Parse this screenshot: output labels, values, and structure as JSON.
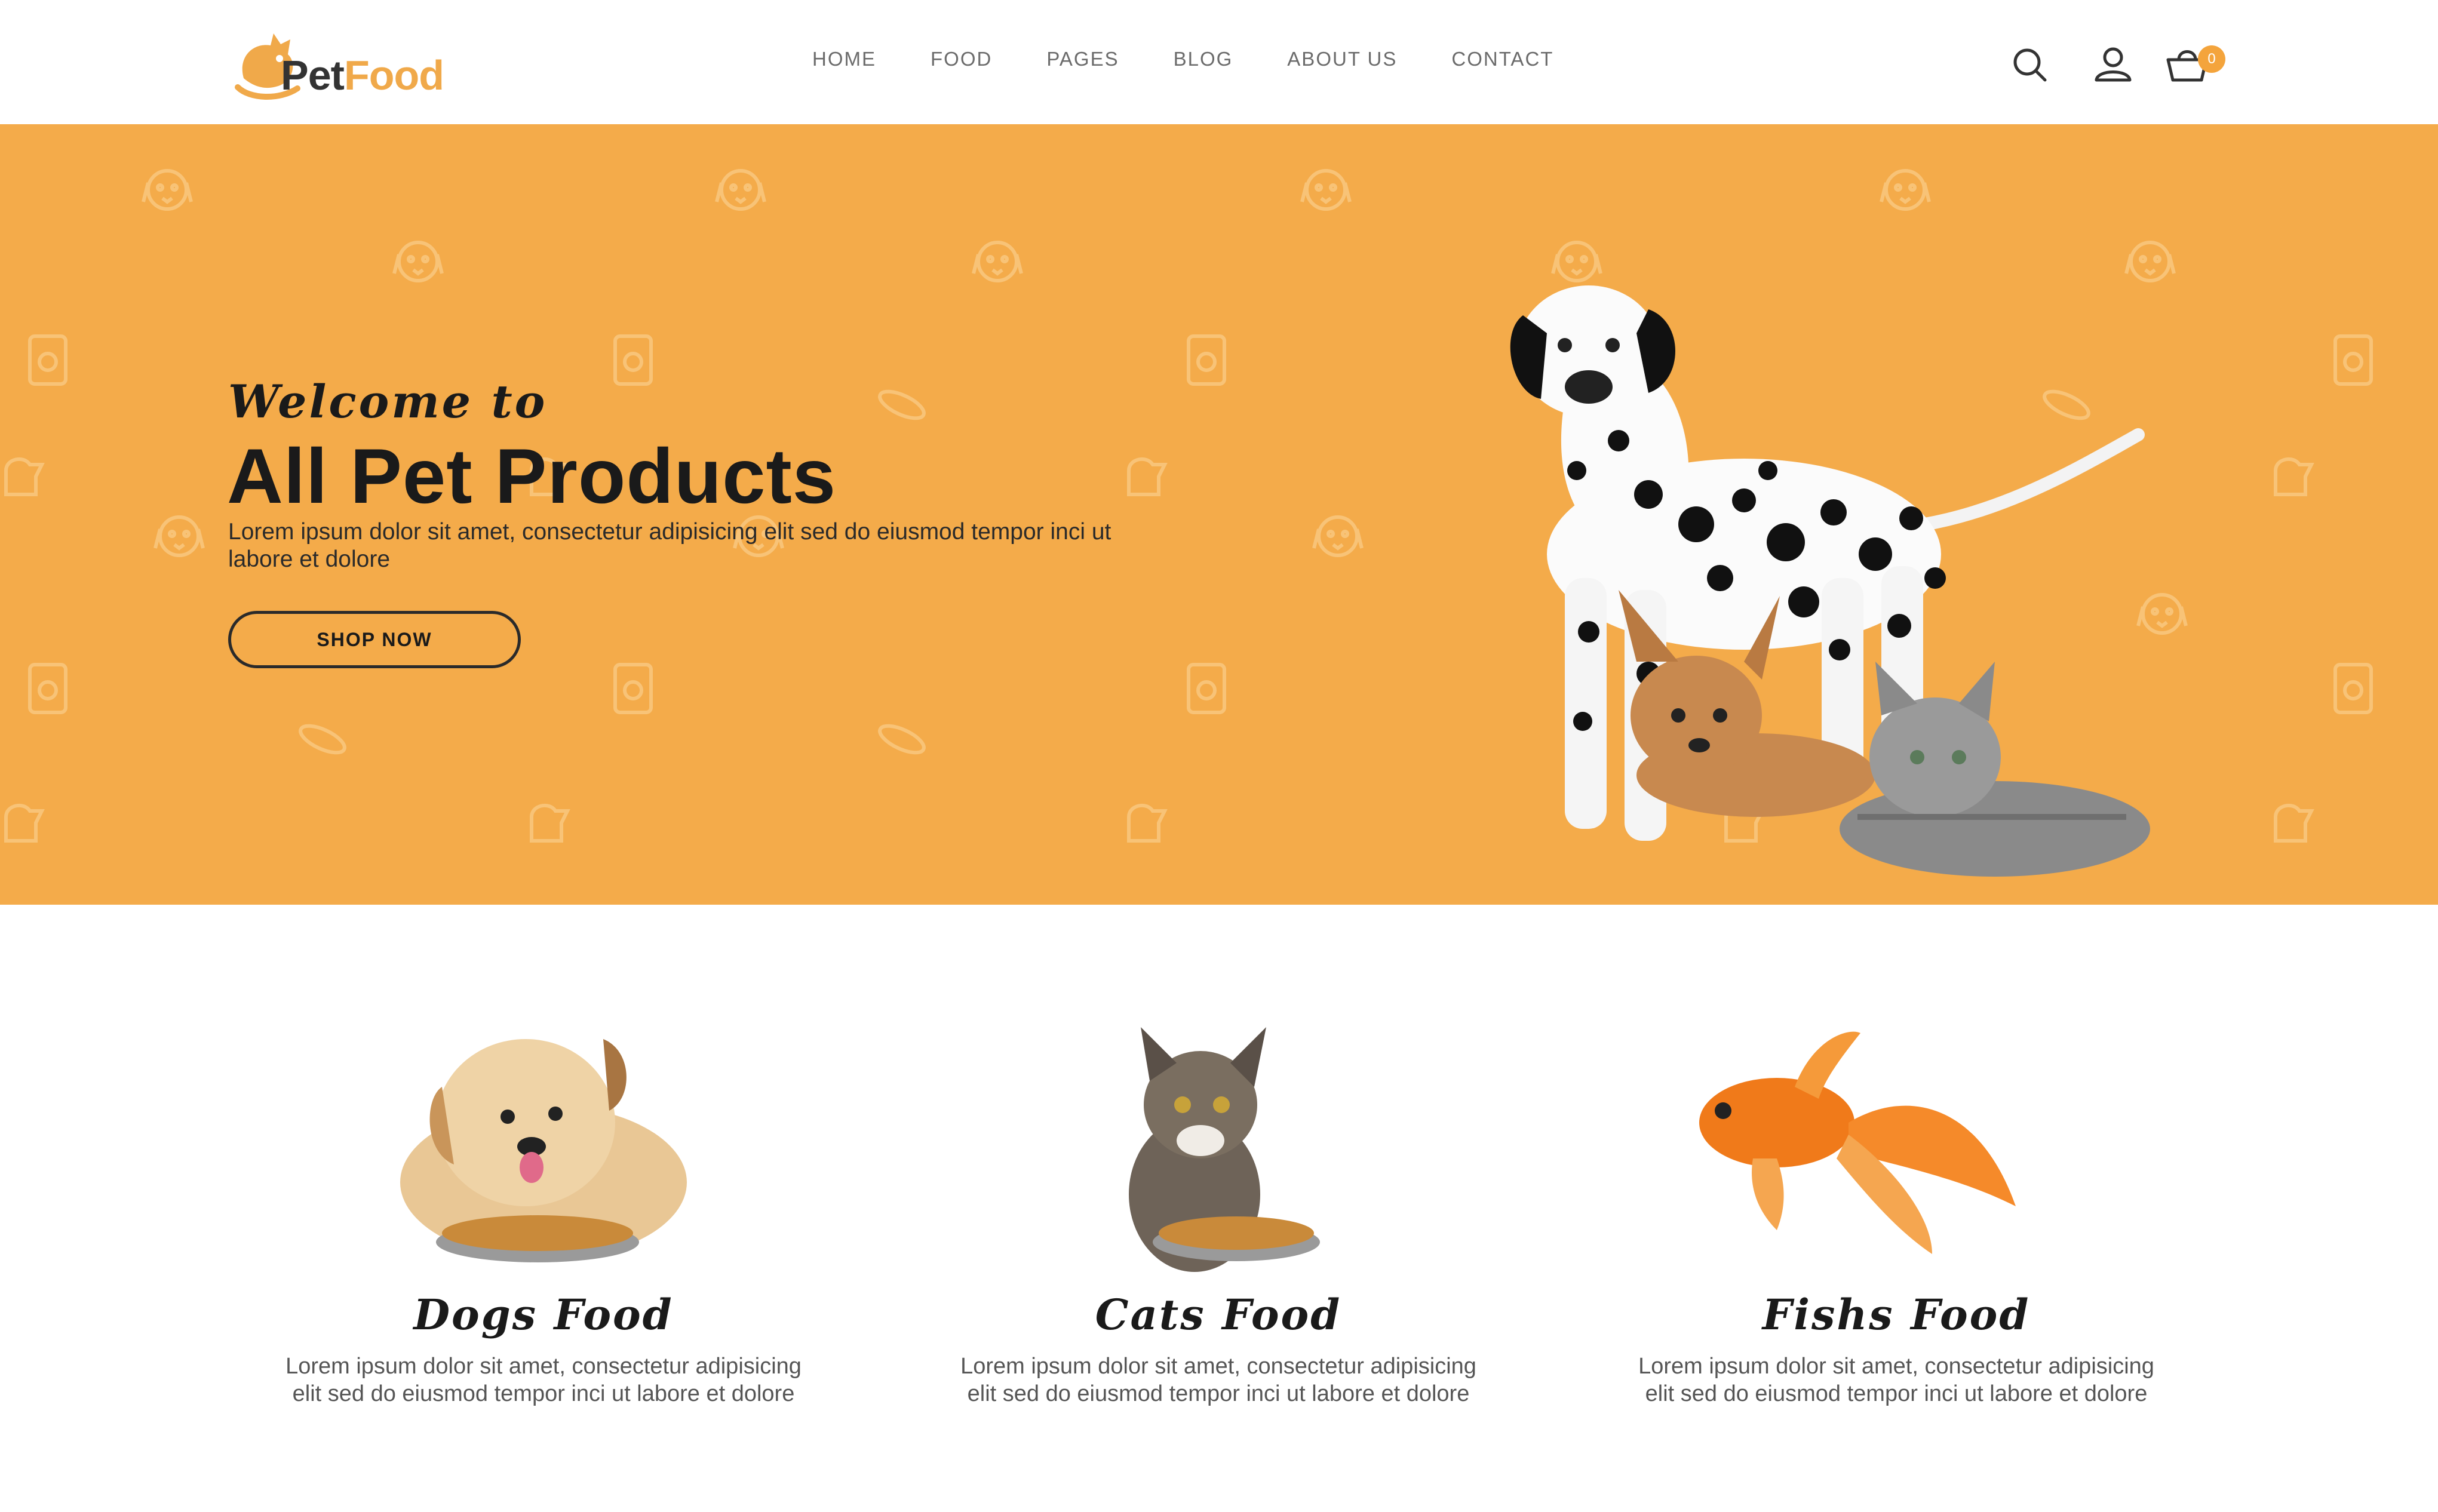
{
  "brand": {
    "name_part1": "Pet",
    "name_part2": "Food",
    "accent": "#f4ab4a"
  },
  "nav": {
    "items": [
      {
        "label": "HOME"
      },
      {
        "label": "FOOD"
      },
      {
        "label": "PAGES"
      },
      {
        "label": "BLOG"
      },
      {
        "label": "ABOUT US"
      },
      {
        "label": "CONTACT"
      }
    ]
  },
  "header_icons": {
    "search": "search-icon",
    "account": "user-icon",
    "cart": "cart-icon",
    "cart_count": "0"
  },
  "hero": {
    "welcome": "Welcome to",
    "title": "All Pet Products",
    "description": "Lorem ipsum dolor sit amet, consectetur adipisicing elit sed do eiusmod tempor inci ut labore et dolore",
    "button_label": "SHOP NOW"
  },
  "categories": [
    {
      "title": "Dogs Food",
      "description": "Lorem ipsum dolor sit amet, consectetur adipisicing elit sed do eiusmod tempor inci ut labore et dolore"
    },
    {
      "title": "Cats Food",
      "description": "Lorem ipsum dolor sit amet, consectetur adipisicing elit sed do eiusmod tempor inci ut labore et dolore"
    },
    {
      "title": "Fishs Food",
      "description": "Lorem ipsum dolor sit amet, consectetur adipisicing elit sed do eiusmod tempor inci ut labore et dolore"
    }
  ]
}
